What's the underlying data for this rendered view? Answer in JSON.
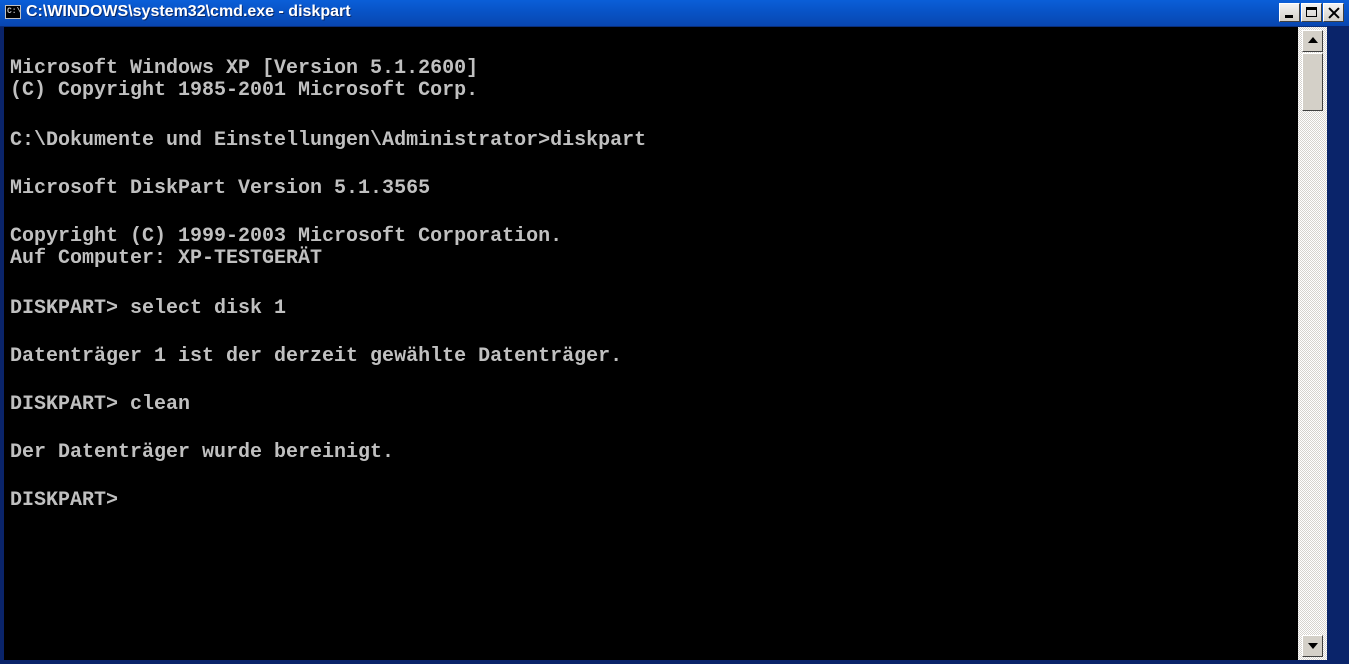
{
  "window": {
    "icon_label": "C:\\",
    "title": "C:\\WINDOWS\\system32\\cmd.exe - diskpart"
  },
  "console": {
    "lines": [
      "Microsoft Windows XP [Version 5.1.2600]",
      "(C) Copyright 1985-2001 Microsoft Corp.",
      "C:\\Dokumente und Einstellungen\\Administrator>diskpart",
      "Microsoft DiskPart Version 5.1.3565",
      "Copyright (C) 1999-2003 Microsoft Corporation.",
      "Auf Computer: XP-TESTGERÄT",
      "DISKPART> select disk 1",
      "Datenträger 1 ist der derzeit gewählte Datenträger.",
      "DISKPART> clean",
      "Der Datenträger wurde bereinigt.",
      "DISKPART>"
    ]
  },
  "colors": {
    "console_bg": "#000000",
    "console_text": "#c0c0c0",
    "titlebar": "#0a5fd8"
  }
}
